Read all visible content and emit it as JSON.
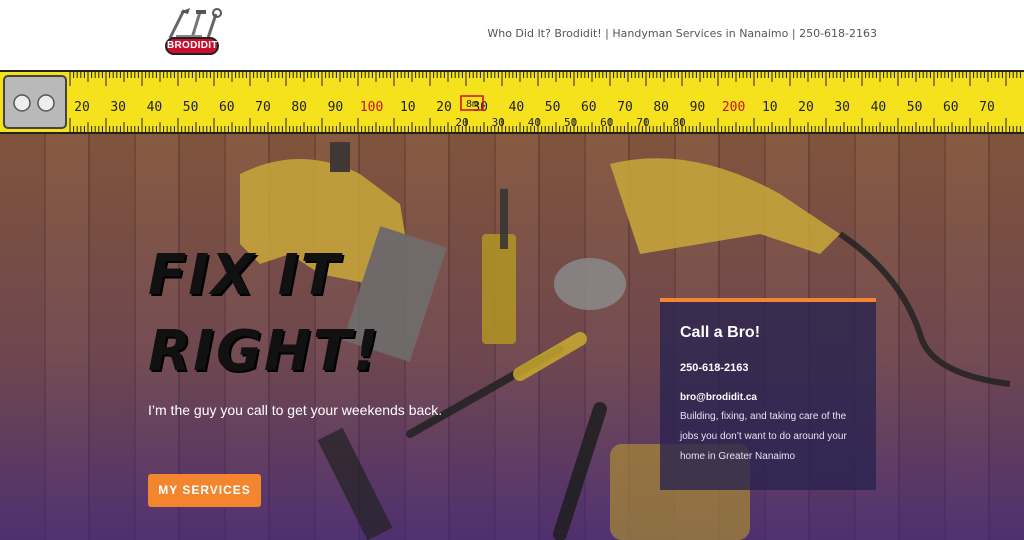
{
  "header": {
    "logo_text": "BRODIDIT",
    "tagline": "Who Did It? Brodidit! | Handyman Services in Nanaimo | 250-618-2163"
  },
  "tape": {
    "upper_numbers": [
      "20",
      "30",
      "40",
      "50",
      "60",
      "70",
      "80",
      "90",
      "100",
      "10",
      "20",
      "30",
      "40",
      "50",
      "60",
      "70",
      "80",
      "90",
      "200",
      "10",
      "20",
      "30",
      "40",
      "50",
      "60",
      "70"
    ],
    "lower_numbers": [
      "20",
      "30",
      "40",
      "50",
      "60",
      "70",
      "80"
    ],
    "marker": "8m"
  },
  "hero": {
    "title": "FIX IT RIGHT!",
    "subtitle": "I’m the guy you call to get your weekends back.",
    "cta_label": "MY SERVICES"
  },
  "card": {
    "title": "Call a Bro!",
    "phone": "250-618-2163",
    "email": "bro@brodidit.ca",
    "description": "Building, fixing, and taking care of the jobs you don’t want to do around your home in Greater Nanaimo"
  },
  "colors": {
    "accent": "#f2852d",
    "tape_yellow": "#f5e21c",
    "logo_red": "#c8102e"
  }
}
